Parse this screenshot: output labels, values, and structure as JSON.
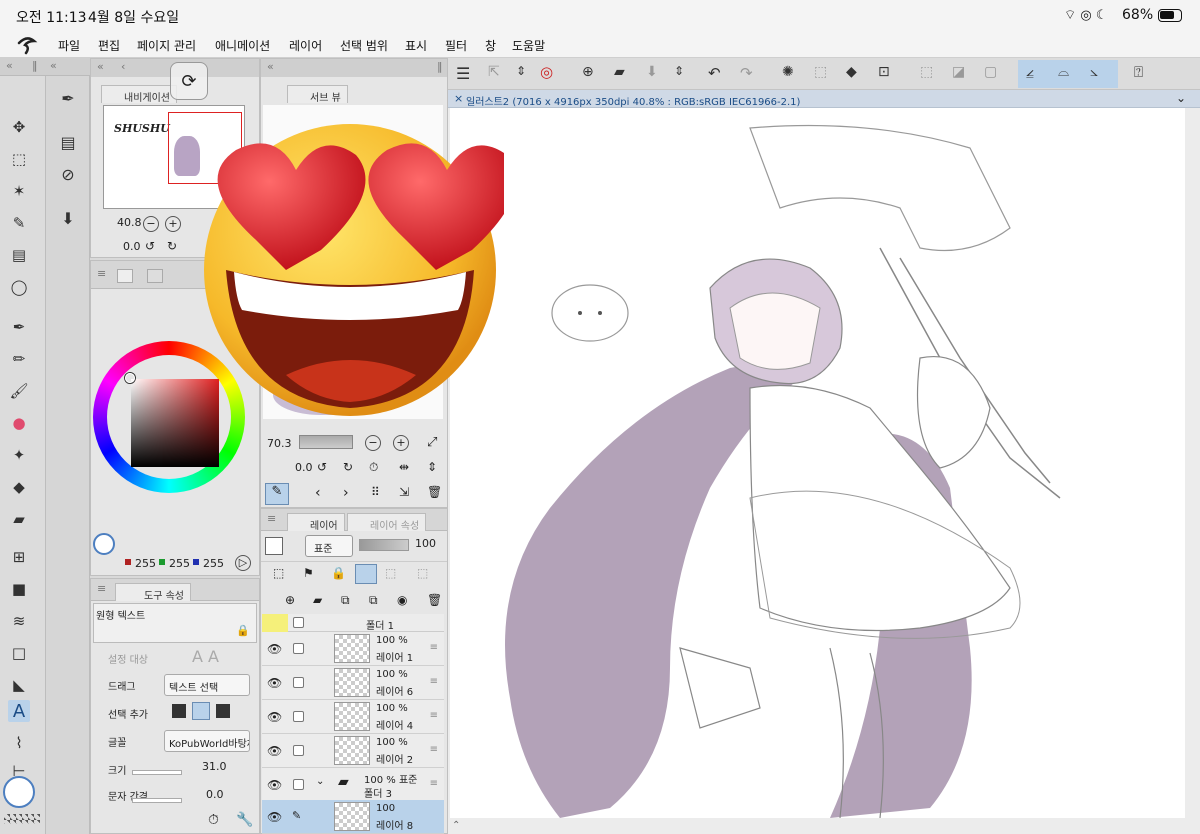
{
  "status": {
    "time": "오전 11:13",
    "date": "4월 8일 수요일",
    "battery": "68%"
  },
  "menu": [
    "파일",
    "편집",
    "페이지 관리",
    "애니메이션",
    "레이어",
    "선택 범위",
    "표시",
    "필터",
    "창",
    "도움말"
  ],
  "navigator": {
    "tab": "내비게이션",
    "zoom": "40.8",
    "rotate": "0.0",
    "doc_label": "SHUSHU"
  },
  "subview": {
    "tab": "서브 뷰",
    "zoom": "70.3",
    "rotate": "0.0"
  },
  "color": {
    "r": "255",
    "g": "255",
    "b": "255",
    "accent": "#b02222"
  },
  "tool_property": {
    "tab": "도구 속성",
    "tool_name": "원형 텍스트",
    "target_label": "설정 대상",
    "drag_label": "드래그",
    "drag_value": "텍스트 선택",
    "select_add_label": "선택 추가",
    "font_label": "글꼴",
    "font_value": "KoPubWorld바탕체",
    "size_label": "크기",
    "size_value": "31.0",
    "spacing_label": "문자 간격",
    "spacing_value": "0.0"
  },
  "layers": {
    "tab": "레이어",
    "tab2": "레이어 속성",
    "blend": "표준",
    "opacity": "100",
    "folder1": "폴더 1",
    "rows": [
      {
        "pct": "100 %",
        "name": "레이어 1"
      },
      {
        "pct": "100 %",
        "name": "레이어 6"
      },
      {
        "pct": "100 %",
        "name": "레이어 4"
      },
      {
        "pct": "100 %",
        "name": "레이어 2"
      }
    ],
    "folder3_pct": "100 %  표준",
    "folder3": "폴더 3",
    "selected_pct": "100",
    "selected_name": "레이어 8"
  },
  "canvas_tab": "일러스트2 (7016 x 4916px 350dpi 40.8% : RGB:sRGB IEC61966-2.1)"
}
